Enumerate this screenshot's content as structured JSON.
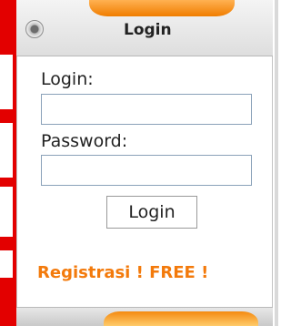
{
  "widget": {
    "title": "Login",
    "login_label": "Login:",
    "login_value": "",
    "password_label": "Password:",
    "password_value": "",
    "submit_label": "Login",
    "register_link": "Registrasi ! FREE !"
  },
  "colors": {
    "accent_orange": "#f37a0b",
    "left_strip_red": "#e30000"
  },
  "icons": {
    "header": "radio-circle-icon"
  }
}
